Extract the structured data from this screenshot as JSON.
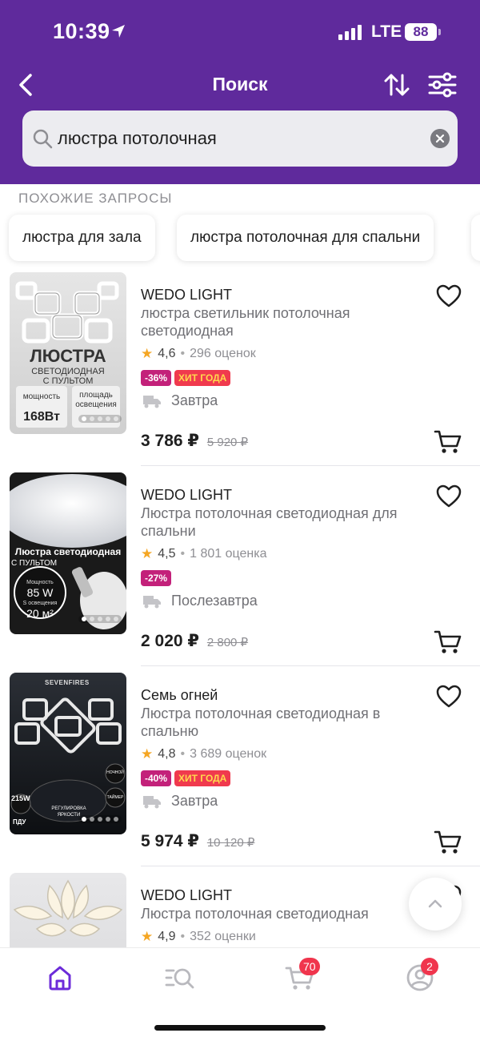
{
  "status_bar": {
    "time": "10:39",
    "network": "LTE",
    "battery": "88"
  },
  "header": {
    "title": "Поиск"
  },
  "search": {
    "query": "люстра потолочная"
  },
  "similar": {
    "label": "ПОХОЖИЕ ЗАПРОСЫ",
    "chips": [
      "люстра для зала",
      "люстра потолочная для спальни"
    ]
  },
  "products": [
    {
      "brand": "WEDO LIGHT",
      "name": "люстра светильник потолочная светодиодная",
      "rating": "4,6",
      "reviews": "296 оценок",
      "discount": "-36%",
      "hit": "ХИТ ГОДА",
      "delivery": "Завтра",
      "price": "3 786 ₽",
      "old_price": "5 920 ₽",
      "thumb": {
        "title": "ЛЮСТРА",
        "subtitle": "СВЕТОДИОДНАЯ С ПУЛЬТОМ",
        "left_label": "мощность",
        "left_value": "168Вт",
        "right_label": "площадь освещения"
      }
    },
    {
      "brand": "WEDO LIGHT",
      "name": "Люстра потолочная светодиодная для спальни",
      "rating": "4,5",
      "reviews": "1 801 оценка",
      "discount": "-27%",
      "hit": "",
      "delivery": "Послезавтра",
      "price": "2 020 ₽",
      "old_price": "2 800 ₽",
      "thumb": {
        "title": "Люстра светодиодная",
        "subtitle": "С ПУЛЬТОМ",
        "power_label": "Мощность",
        "power_value": "85 W",
        "area_label": "S освещения",
        "area_value": "20 м²"
      }
    },
    {
      "brand": "Семь огней",
      "name": "Люстра потолочная светодиодная в спальню",
      "rating": "4,8",
      "reviews": "3 689 оценок",
      "discount": "-40%",
      "hit": "ХИТ ГОДА",
      "delivery": "Завтра",
      "price": "5 974 ₽",
      "old_price": "10 120 ₽",
      "thumb": {
        "logo": "SEVENFIRES",
        "power": "215W",
        "remote": "ПДУ",
        "brightness": "РЕГУЛИРОВКА ЯРКОСТИ",
        "night": "НОЧНОЙ",
        "timer": "ТАЙМЕР"
      }
    },
    {
      "brand": "WEDO LIGHT",
      "name": "Люстра потолочная светодиодная",
      "rating": "4,9",
      "reviews": "352 оценки"
    }
  ],
  "tabbar": {
    "cart_count": "70",
    "profile_count": "2"
  },
  "colors": {
    "brand": "#5f2a9c",
    "discount": "#c3217a",
    "hit": "#f03a4e",
    "star": "#f5a623",
    "badge": "#f0354d"
  }
}
